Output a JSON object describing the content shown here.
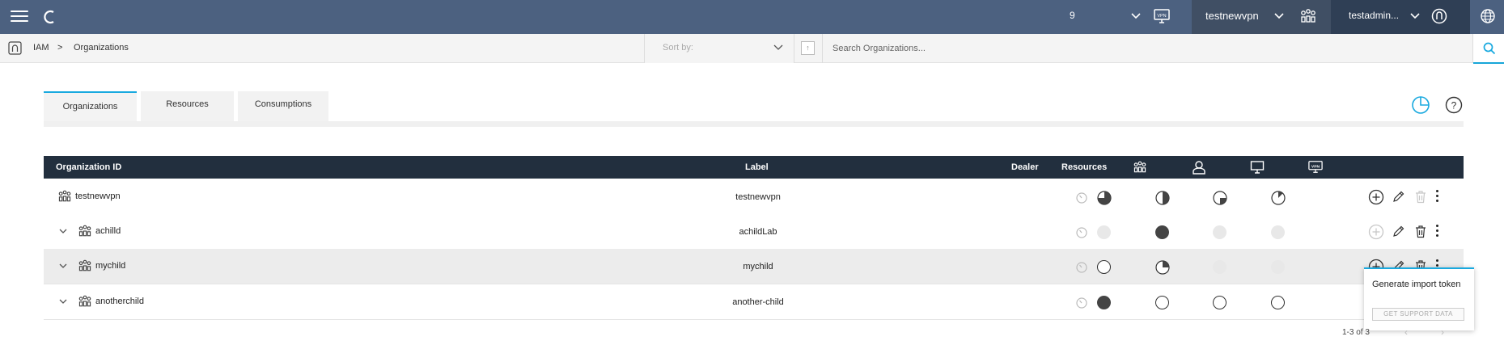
{
  "topbar": {
    "menu_icon": "hamburger-icon",
    "logo_icon": "c-logo-icon",
    "notification_count": "9",
    "org_name": "testnewvpn",
    "user_name": "testadmin...",
    "bg": "#4c6180"
  },
  "breadcrumb": {
    "root": "IAM",
    "separator": ">",
    "current": "Organizations"
  },
  "sort": {
    "placeholder": "Sort by:",
    "direction": "↑"
  },
  "search": {
    "placeholder": "Search Organizations..."
  },
  "tabs": [
    {
      "label": "Organizations",
      "active": true
    },
    {
      "label": "Resources",
      "active": false
    },
    {
      "label": "Consumptions",
      "active": false
    }
  ],
  "table": {
    "headers": {
      "org_id": "Organization ID",
      "label": "Label",
      "dealer": "Dealer",
      "resources": "Resources",
      "col_icons": [
        "network-devices-icon",
        "user-icon",
        "desktop-icon",
        "vpn-icon"
      ]
    },
    "rows": [
      {
        "org_id": "testnewvpn",
        "label": "testnewvpn",
        "expandable": false,
        "usage": [
          "three-quarter",
          "half",
          "quarter",
          "eighth"
        ],
        "add_enabled": true,
        "delete_enabled": false
      },
      {
        "org_id": "achilld",
        "label": "achildLab",
        "expandable": true,
        "usage": [
          "disabled",
          "full",
          "disabled",
          "disabled"
        ],
        "add_enabled": false,
        "delete_enabled": true
      },
      {
        "org_id": "mychild",
        "label": "mychild",
        "expandable": true,
        "highlighted": true,
        "usage": [
          "empty",
          "quarter-left",
          "disabled",
          "disabled"
        ],
        "add_enabled": true,
        "delete_enabled": true
      },
      {
        "org_id": "anotherchild",
        "label": "another-child",
        "expandable": true,
        "usage": [
          "full",
          "empty",
          "empty",
          "empty"
        ],
        "add_enabled": true,
        "delete_enabled": true
      }
    ]
  },
  "context_menu": {
    "item": "Generate import token",
    "button": "GET SUPPORT DATA"
  },
  "pagination": {
    "text": "1-3 of 3",
    "prev": "‹",
    "next": "›"
  },
  "accent": "#19a9df"
}
